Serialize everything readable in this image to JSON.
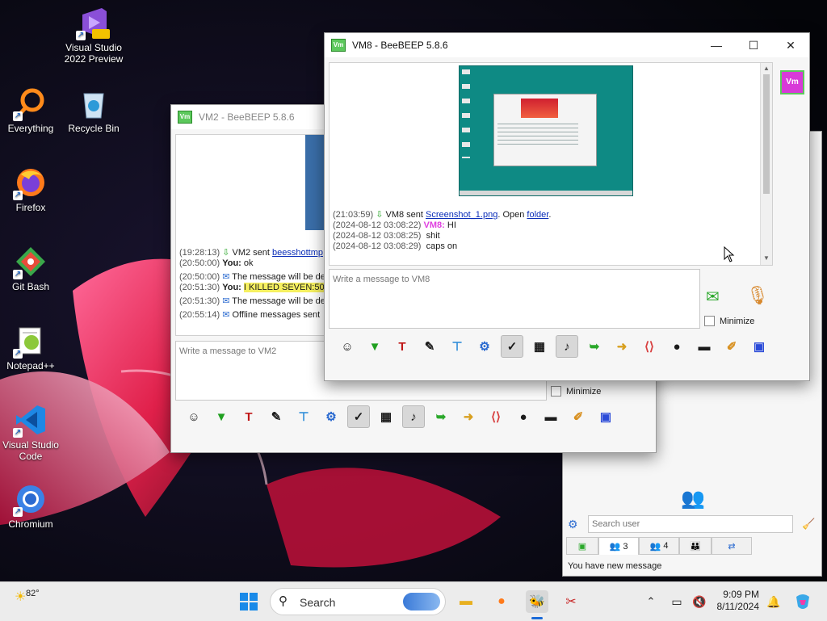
{
  "desktop": {
    "icons": [
      {
        "label": "Visual Studio 2022 Preview",
        "badge": "PRE"
      },
      {
        "label": "Everything"
      },
      {
        "label": "Recycle Bin"
      },
      {
        "label": "Firefox"
      },
      {
        "label": "Git Bash"
      },
      {
        "label": "Notepad++"
      },
      {
        "label": "Visual Studio Code"
      },
      {
        "label": "Chromium"
      }
    ]
  },
  "vm2_window": {
    "title": "VM2 - BeeBEEP 5.8.6",
    "log": [
      {
        "time": "(19:28:13)",
        "sender": "VM2 sent",
        "link": "beesshottmp"
      },
      {
        "time": "(20:50:00)",
        "who": "You:",
        "text": "ok"
      },
      {
        "time": "(20:50:00)",
        "text": "The message will be de"
      },
      {
        "time": "(20:51:30)",
        "who": "You:",
        "text": "I KILLED SEVEN:50 C"
      },
      {
        "time": "(20:51:30)",
        "text": "The message will be de"
      },
      {
        "time": "(20:55:14)",
        "text": "Offline messages sent"
      }
    ],
    "input_placeholder": "Write a message to VM2",
    "minimize_label": "Minimize"
  },
  "vm8_window": {
    "title": "VM8 - BeeBEEP 5.8.6",
    "avatar_text": "Vm",
    "log": [
      {
        "time": "(21:03:59)",
        "sender": "VM8 sent",
        "link": "Screenshot_1.png",
        "open": ". Open",
        "folder": "folder",
        "end": "."
      },
      {
        "time": "(2024-08-12 03:08:22)",
        "nick": "VM8:",
        "text": "HI"
      },
      {
        "time": "(2024-08-12 03:08:25)",
        "text": "shit"
      },
      {
        "time": "(2024-08-12 03:08:29)",
        "text": "caps on"
      }
    ],
    "input_placeholder": "Write a message to VM8",
    "minimize_label": "Minimize"
  },
  "contacts_panel": {
    "search_placeholder": "Search user",
    "tabs": [
      {
        "count": "3"
      },
      {
        "count": "4"
      },
      {
        "count": ""
      },
      {
        "count": ""
      }
    ],
    "status": "You have new message"
  },
  "toolbar_icons": [
    "emoticon-icon",
    "arrow-down-icon",
    "font-icon",
    "color-pencil-icon",
    "filter-icon",
    "settings-icon",
    "check-icon",
    "image-icon",
    "music-icon",
    "send-file-icon",
    "folder-share-icon",
    "html-icon",
    "screenshot-icon",
    "terminal-icon",
    "notes-icon",
    "save-icon"
  ],
  "taskbar": {
    "weather": "82°",
    "search_label": "Search",
    "time": "9:09 PM",
    "date": "8/11/2024"
  },
  "colors": {
    "accent": "#5cc85c",
    "link": "#0a2db8",
    "nick": "#e040e0",
    "highlight": "#f6f060"
  }
}
